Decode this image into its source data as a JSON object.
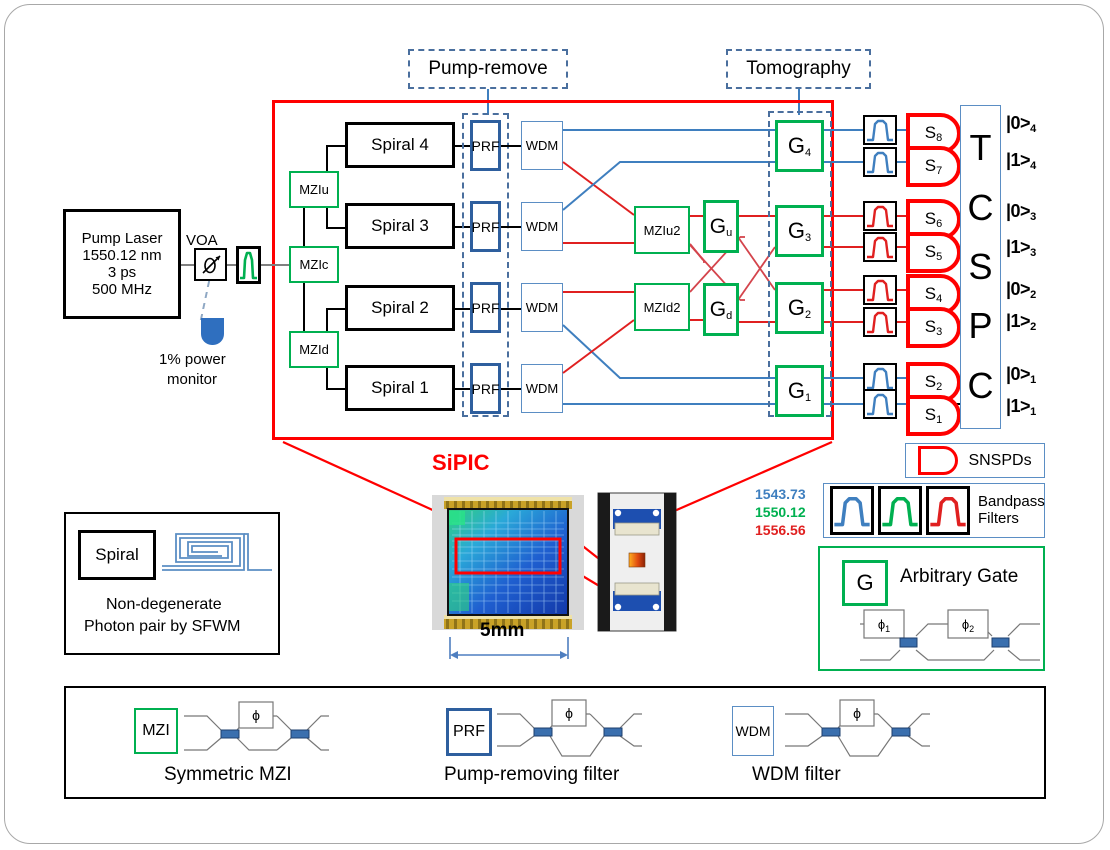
{
  "figure": {
    "sipic_label": "SiPIC",
    "annotations": {
      "pump_remove": "Pump-remove",
      "tomography": "Tomography"
    }
  },
  "source": {
    "laser": {
      "lines": [
        "Pump Laser",
        "1550.12 nm",
        "3 ps",
        "500 MHz"
      ]
    },
    "voa_label": "VOA",
    "monitor_lines": [
      "1% power",
      "monitor"
    ]
  },
  "mzi_tree": {
    "mzlc": "MZIc",
    "mzlu": "MZIu",
    "mzld": "MZId"
  },
  "spirals": [
    {
      "label": "Spiral 1"
    },
    {
      "label": "Spiral 2"
    },
    {
      "label": "Spiral 3"
    },
    {
      "label": "Spiral 4"
    }
  ],
  "prf_label": "PRF",
  "wdm_label": "WDM",
  "mzi_second": {
    "up": "MZIu2",
    "down": "MZId2"
  },
  "gates": {
    "gu": "G",
    "gu_sub": "u",
    "gd": "G",
    "gd_sub": "d",
    "g1": "G",
    "g1_sub": "1",
    "g2": "G",
    "g2_sub": "2",
    "g3": "G",
    "g3_sub": "3",
    "g4": "G",
    "g4_sub": "4"
  },
  "detectors": [
    {
      "label": "S",
      "sub": "8",
      "filter_color": "#3f7fbf"
    },
    {
      "label": "S",
      "sub": "7",
      "filter_color": "#3f7fbf"
    },
    {
      "label": "S",
      "sub": "6",
      "filter_color": "#e02020"
    },
    {
      "label": "S",
      "sub": "5",
      "filter_color": "#e02020"
    },
    {
      "label": "S",
      "sub": "4",
      "filter_color": "#e02020"
    },
    {
      "label": "S",
      "sub": "3",
      "filter_color": "#e02020"
    },
    {
      "label": "S",
      "sub": "2",
      "filter_color": "#3f7fbf"
    },
    {
      "label": "S",
      "sub": "1",
      "filter_color": "#3f7fbf"
    }
  ],
  "tcspc": {
    "letters": [
      "T",
      "C",
      "S",
      "P",
      "C"
    ]
  },
  "qubit_outputs": [
    {
      "ket": "|0>",
      "sub": "4"
    },
    {
      "ket": "|1>",
      "sub": "4"
    },
    {
      "ket": "|0>",
      "sub": "3"
    },
    {
      "ket": "|1>",
      "sub": "3"
    },
    {
      "ket": "|0>",
      "sub": "2"
    },
    {
      "ket": "|1>",
      "sub": "2"
    },
    {
      "ket": "|0>",
      "sub": "1"
    },
    {
      "ket": "|1>",
      "sub": "1"
    }
  ],
  "wavelengths": [
    {
      "value": "1543.73",
      "color": "#3f7fbf"
    },
    {
      "value": "1550.12",
      "color": "#00b050"
    },
    {
      "value": "1556.56",
      "color": "#e02020"
    }
  ],
  "legends": {
    "snspds": "SNSPDs",
    "bandpass_lines": [
      "Bandpass",
      "Filters"
    ],
    "arbitrary_gate": {
      "badge": "G",
      "title": "Arbitrary Gate",
      "phi1": "ϕ",
      "phi1_sub": "1",
      "phi2": "ϕ",
      "phi2_sub": "2"
    },
    "spiral": {
      "badge": "Spiral",
      "lines": [
        "Non-degenerate",
        "Photon pair by SFWM"
      ]
    },
    "bottom": [
      {
        "badge": "MZI",
        "badge_style": "green",
        "caption": "Symmetric MZI",
        "phi": "ϕ"
      },
      {
        "badge": "PRF",
        "badge_style": "blue",
        "caption": "Pump-removing filter",
        "phi": "ϕ"
      },
      {
        "badge": "WDM",
        "badge_style": "bluethin",
        "caption": "WDM filter",
        "phi": "ϕ"
      }
    ]
  },
  "chip": {
    "scale_label": "5mm"
  },
  "colors": {
    "red": "#ff0000",
    "blue_wire": "#3f7fbf",
    "red_wire": "#e02020",
    "green": "#00b050",
    "prf_blue": "#2e5f9e",
    "wdm_blue": "#5b8ec4",
    "dash_blue": "#4a6f9e"
  }
}
